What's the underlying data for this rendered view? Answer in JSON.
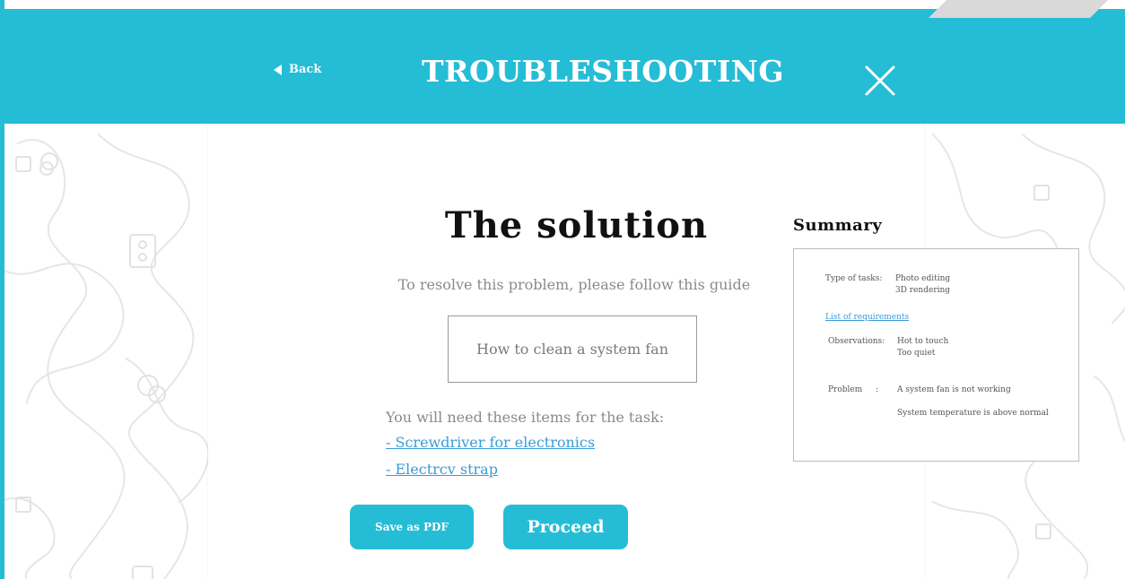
{
  "header": {
    "back_label": "Back",
    "title": "TROUBLESHOOTING"
  },
  "main": {
    "title": "The solution",
    "subtitle": "To resolve this problem, please follow this guide",
    "guide_label": "How to clean a system fan",
    "items_intro": "You will need these items for the task:",
    "items": [
      "- Screwdriver for electronics",
      "- Electrcv strap"
    ],
    "save_pdf_label": "Save as PDF",
    "proceed_label": "Proceed"
  },
  "summary": {
    "title": "Summary",
    "type_label": "Type of tasks:",
    "types": [
      "Photo editing",
      "3D rendering"
    ],
    "requirements_link": "List of requirements",
    "observations_label": "Observations:",
    "observations": [
      "Hot to touch",
      "Too quiet"
    ],
    "problem_label": "Problem",
    "problem_sep": ":",
    "problems": [
      "A system fan is not working",
      "System temperature is above normal"
    ]
  },
  "colors": {
    "accent": "#25bcd6",
    "link": "#3a9bd9",
    "text_muted": "#8a8a8a"
  },
  "icons": {
    "back": "back-arrow-icon",
    "close": "close-icon"
  }
}
